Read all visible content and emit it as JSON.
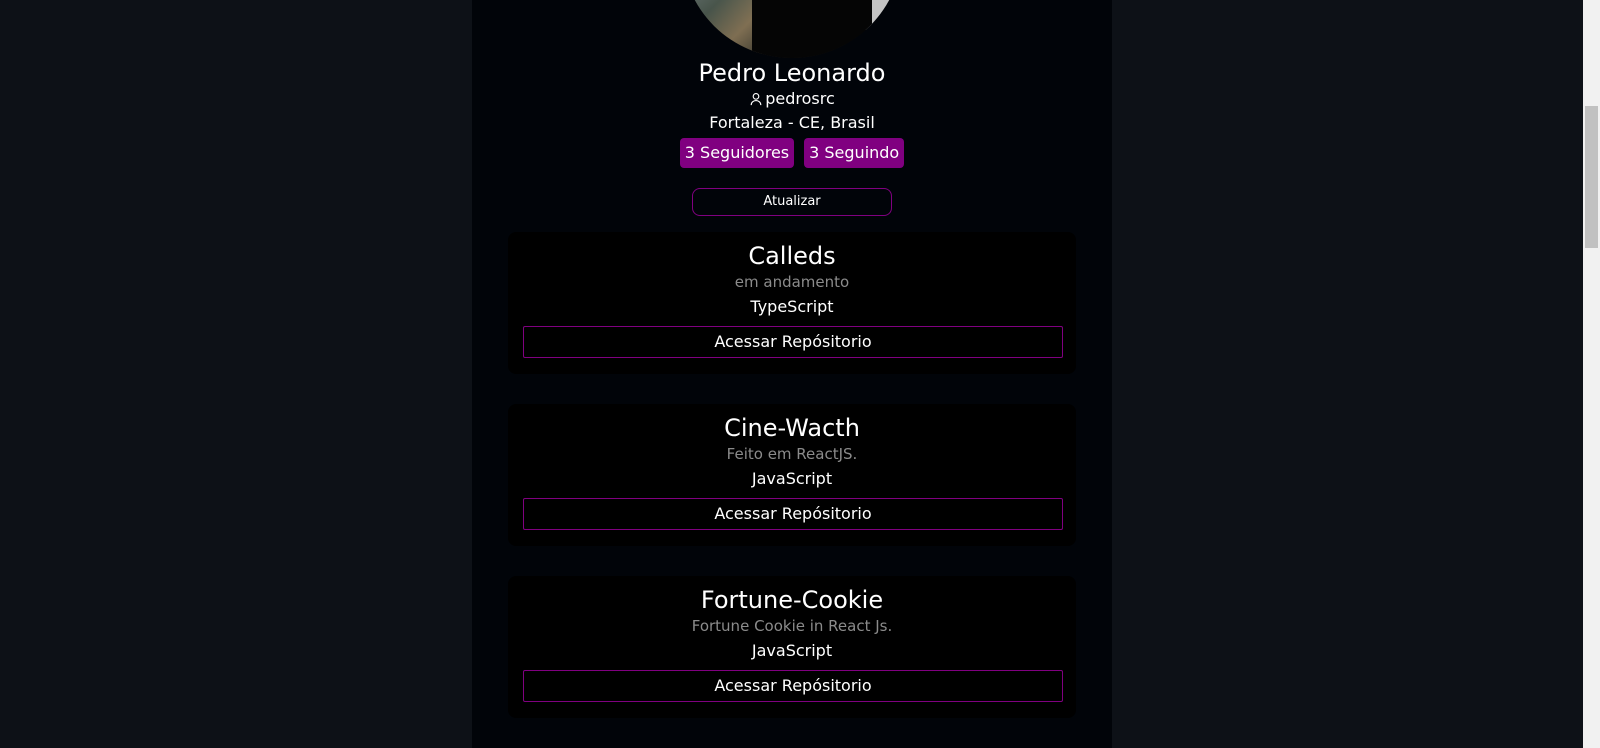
{
  "profile": {
    "name": "Pedro Leonardo",
    "login": "pedrosrc",
    "location": "Fortaleza - CE, Brasil",
    "followers_label": "3 Seguidores",
    "following_label": "3 Seguindo",
    "update_label": "Atualizar"
  },
  "repos": [
    {
      "name": "Calleds",
      "description": "em andamento",
      "language": "TypeScript",
      "button_label": "Acessar Repósitorio"
    },
    {
      "name": "Cine-Wacth",
      "description": "Feito em ReactJS.",
      "language": "JavaScript",
      "button_label": "Acessar Repósitorio"
    },
    {
      "name": "Fortune-Cookie",
      "description": "Fortune Cookie in React Js.",
      "language": "JavaScript",
      "button_label": "Acessar Repósitorio"
    }
  ],
  "icons": {
    "user": "user-icon"
  },
  "colors": {
    "page_background": "#0d1117",
    "column_background": "#010409",
    "card_background": "#000000",
    "accent": "#800080",
    "muted_text": "#8b8b8b"
  }
}
